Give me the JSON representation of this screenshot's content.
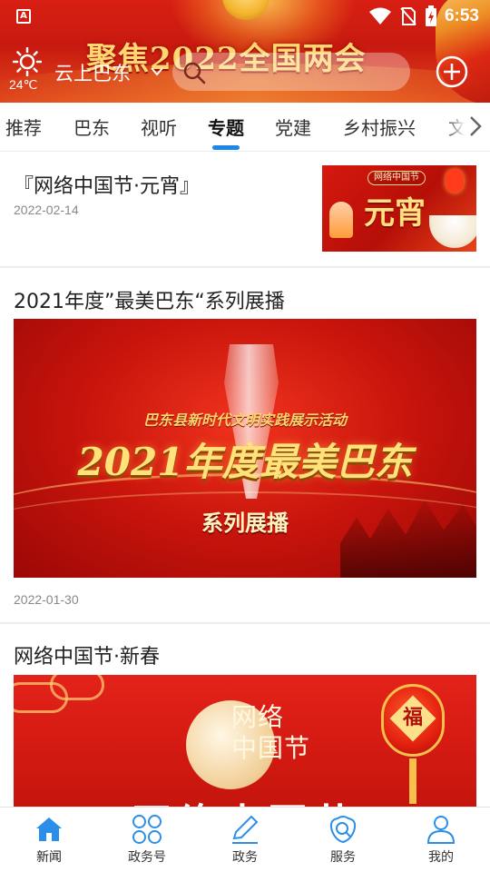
{
  "header": {
    "banner_title": "聚焦2022全国两会",
    "weather_temp": "24℃",
    "brand": "云上巴东",
    "search_placeholder": "",
    "status_time": "6:53",
    "status_app_icon_letter": "A"
  },
  "tabs": [
    {
      "label": "推荐"
    },
    {
      "label": "巴东"
    },
    {
      "label": "视听"
    },
    {
      "label": "专题",
      "active": true
    },
    {
      "label": "党建"
    },
    {
      "label": "乡村振兴"
    },
    {
      "label": "文"
    }
  ],
  "feed": [
    {
      "title": "『网络中国节·元宵』",
      "date": "2022-02-14",
      "thumb": {
        "badge": "网络中国节",
        "title": "元宵"
      }
    },
    {
      "title": "2021年度”最美巴东“系列展播",
      "date": "2022-01-30",
      "banner": {
        "subtitle": "巴东县新时代文明实践展示活动",
        "main": "2021年度最美巴东",
        "series": "系列展播"
      }
    },
    {
      "title": "网络中国节·新春",
      "banner": {
        "logo_line1": "网络",
        "logo_line2": "中国节",
        "lantern_char": "福",
        "big_text": "网络中国节"
      }
    }
  ],
  "bottom_nav": [
    {
      "label": "新闻",
      "icon": "home-icon",
      "active": true
    },
    {
      "label": "政务号",
      "icon": "clover-icon"
    },
    {
      "label": "政务",
      "icon": "pen-icon"
    },
    {
      "label": "服务",
      "icon": "service-search-icon"
    },
    {
      "label": "我的",
      "icon": "user-icon"
    }
  ],
  "colors": {
    "header_red": "#d81f13",
    "accent_blue": "#1e86e6",
    "nav_blue": "#2b8ee8",
    "date_gray": "#888888"
  }
}
